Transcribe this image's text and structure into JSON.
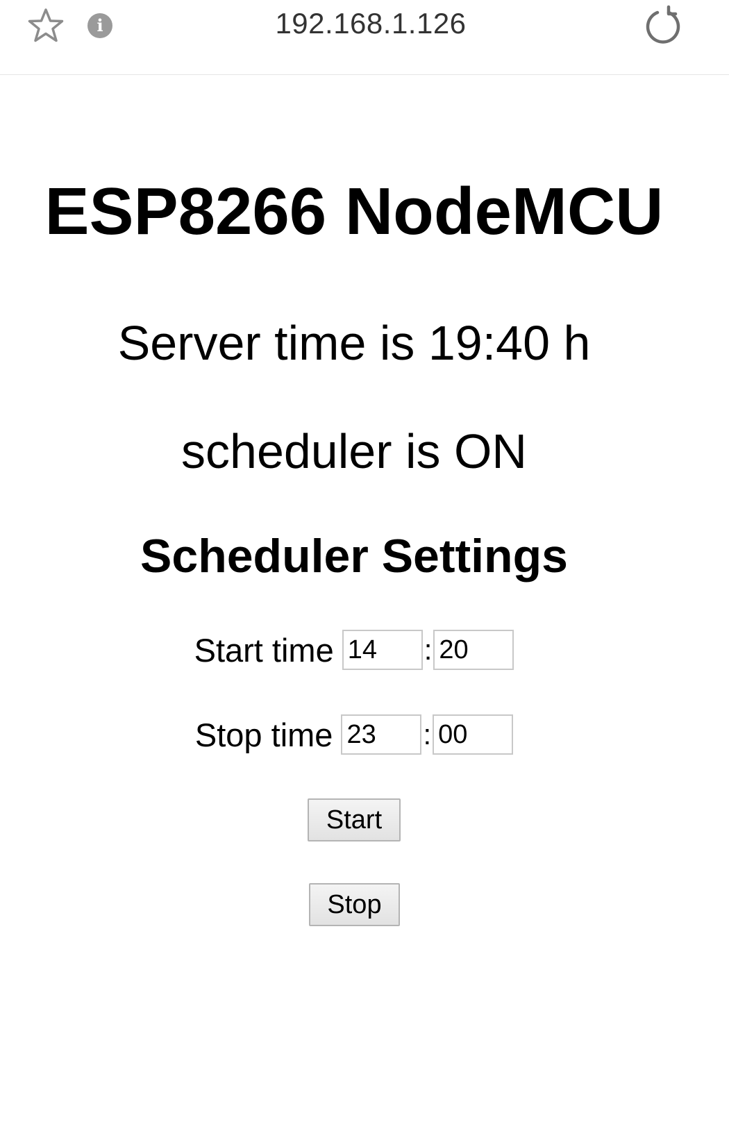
{
  "browser": {
    "url": "192.168.1.126",
    "icons": {
      "bookmark": "star-icon",
      "site_info": "info-icon",
      "reload": "reload-icon"
    },
    "info_glyph": "i"
  },
  "page": {
    "title": "ESP8266 NodeMCU",
    "server_time": "Server time is 19:40 h",
    "scheduler_status": "scheduler is ON",
    "section_title": "Scheduler Settings"
  },
  "schedule": {
    "start": {
      "label": "Start time",
      "hour": "14",
      "separator": ":",
      "minute": "20"
    },
    "stop": {
      "label": "Stop time",
      "hour": "23",
      "separator": ":",
      "minute": "00"
    }
  },
  "buttons": {
    "start_label": "Start",
    "stop_label": "Stop"
  }
}
